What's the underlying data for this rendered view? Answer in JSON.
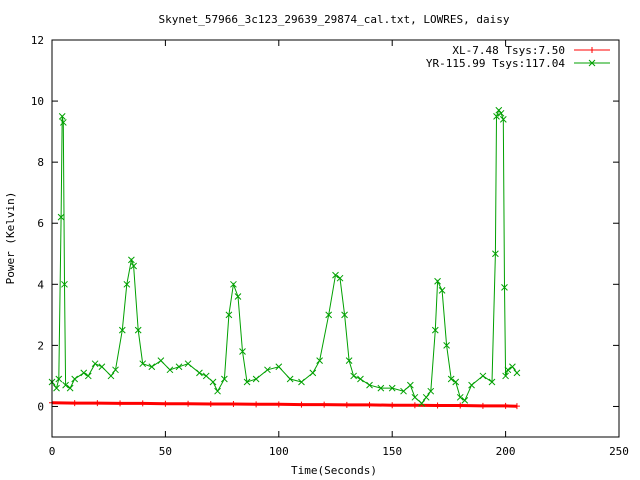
{
  "chart_data": {
    "type": "line",
    "title": "Skynet_57966_3c123_29639_29874_cal.txt, LOWRES, daisy",
    "xlabel": "Time(Seconds)",
    "ylabel": "Power (Kelvin)",
    "xlim": [
      0,
      250
    ],
    "ylim": [
      -1,
      12
    ],
    "x_ticks": [
      0,
      50,
      100,
      150,
      200,
      250
    ],
    "y_ticks": [
      0,
      2,
      4,
      6,
      8,
      10,
      12
    ],
    "grid": false,
    "legend_position": "top-right",
    "series": [
      {
        "name": "XL-7.48 Tsys:7.50",
        "color": "#ff0000",
        "marker": "plus",
        "x": [
          0,
          10,
          20,
          30,
          40,
          50,
          60,
          70,
          80,
          90,
          100,
          110,
          120,
          130,
          140,
          150,
          160,
          170,
          180,
          190,
          200,
          205
        ],
        "y": [
          0.12,
          0.11,
          0.11,
          0.1,
          0.1,
          0.09,
          0.09,
          0.08,
          0.08,
          0.07,
          0.07,
          0.06,
          0.06,
          0.05,
          0.05,
          0.04,
          0.04,
          0.03,
          0.03,
          0.02,
          0.02,
          0.01
        ]
      },
      {
        "name": "YR-115.99 Tsys:117.04",
        "color": "#00a000",
        "marker": "x",
        "x": [
          0,
          2,
          3,
          4,
          4.5,
          5,
          5.5,
          6,
          8,
          10,
          14,
          16,
          19,
          22,
          26,
          28,
          31,
          33,
          35,
          36,
          38,
          40,
          44,
          48,
          52,
          56,
          60,
          65,
          68,
          71,
          73,
          76,
          78,
          80,
          82,
          84,
          86,
          90,
          95,
          100,
          105,
          110,
          115,
          118,
          122,
          125,
          127,
          129,
          131,
          133,
          136,
          140,
          145,
          150,
          155,
          158,
          160,
          163,
          165,
          167,
          169,
          170,
          172,
          174,
          176,
          178,
          180,
          182,
          185,
          190,
          194,
          195.5,
          196,
          197,
          198,
          199,
          199.5,
          200,
          201,
          203,
          205
        ],
        "y": [
          0.8,
          0.6,
          0.9,
          6.2,
          9.5,
          9.3,
          4.0,
          0.7,
          0.6,
          0.9,
          1.1,
          1.0,
          1.4,
          1.3,
          1.0,
          1.2,
          2.5,
          4.0,
          4.8,
          4.6,
          2.5,
          1.4,
          1.3,
          1.5,
          1.2,
          1.3,
          1.4,
          1.1,
          1.0,
          0.8,
          0.5,
          0.9,
          3.0,
          4.0,
          3.6,
          1.8,
          0.8,
          0.9,
          1.2,
          1.3,
          0.9,
          0.8,
          1.1,
          1.5,
          3.0,
          4.3,
          4.2,
          3.0,
          1.5,
          1.0,
          0.9,
          0.7,
          0.6,
          0.6,
          0.5,
          0.7,
          0.3,
          0.1,
          0.3,
          0.5,
          2.5,
          4.1,
          3.8,
          2.0,
          0.9,
          0.8,
          0.3,
          0.2,
          0.7,
          1.0,
          0.8,
          5.0,
          9.5,
          9.7,
          9.6,
          9.4,
          3.9,
          1.0,
          1.2,
          1.3,
          1.1
        ]
      }
    ]
  }
}
